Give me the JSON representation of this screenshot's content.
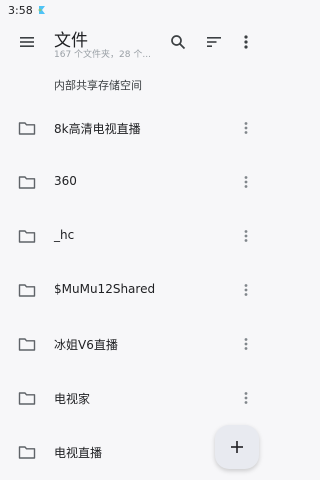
{
  "status": {
    "time": "3:58"
  },
  "appbar": {
    "title": "文件",
    "subtitle": "167 个文件夹，28 个...",
    "menu_icon": "menu-icon",
    "search_icon": "search-icon",
    "sort_icon": "sort-icon",
    "overflow_icon": "more-vert-icon"
  },
  "storage_label": "内部共享存储空间",
  "folders": [
    {
      "name": "8k高清电视直播"
    },
    {
      "name": "360"
    },
    {
      "name": "_hc"
    },
    {
      "name": "$MuMu12Shared"
    },
    {
      "name": "冰姐V6直播"
    },
    {
      "name": "电视家"
    },
    {
      "name": "电视直播"
    }
  ],
  "fab": {
    "icon": "add-icon"
  }
}
